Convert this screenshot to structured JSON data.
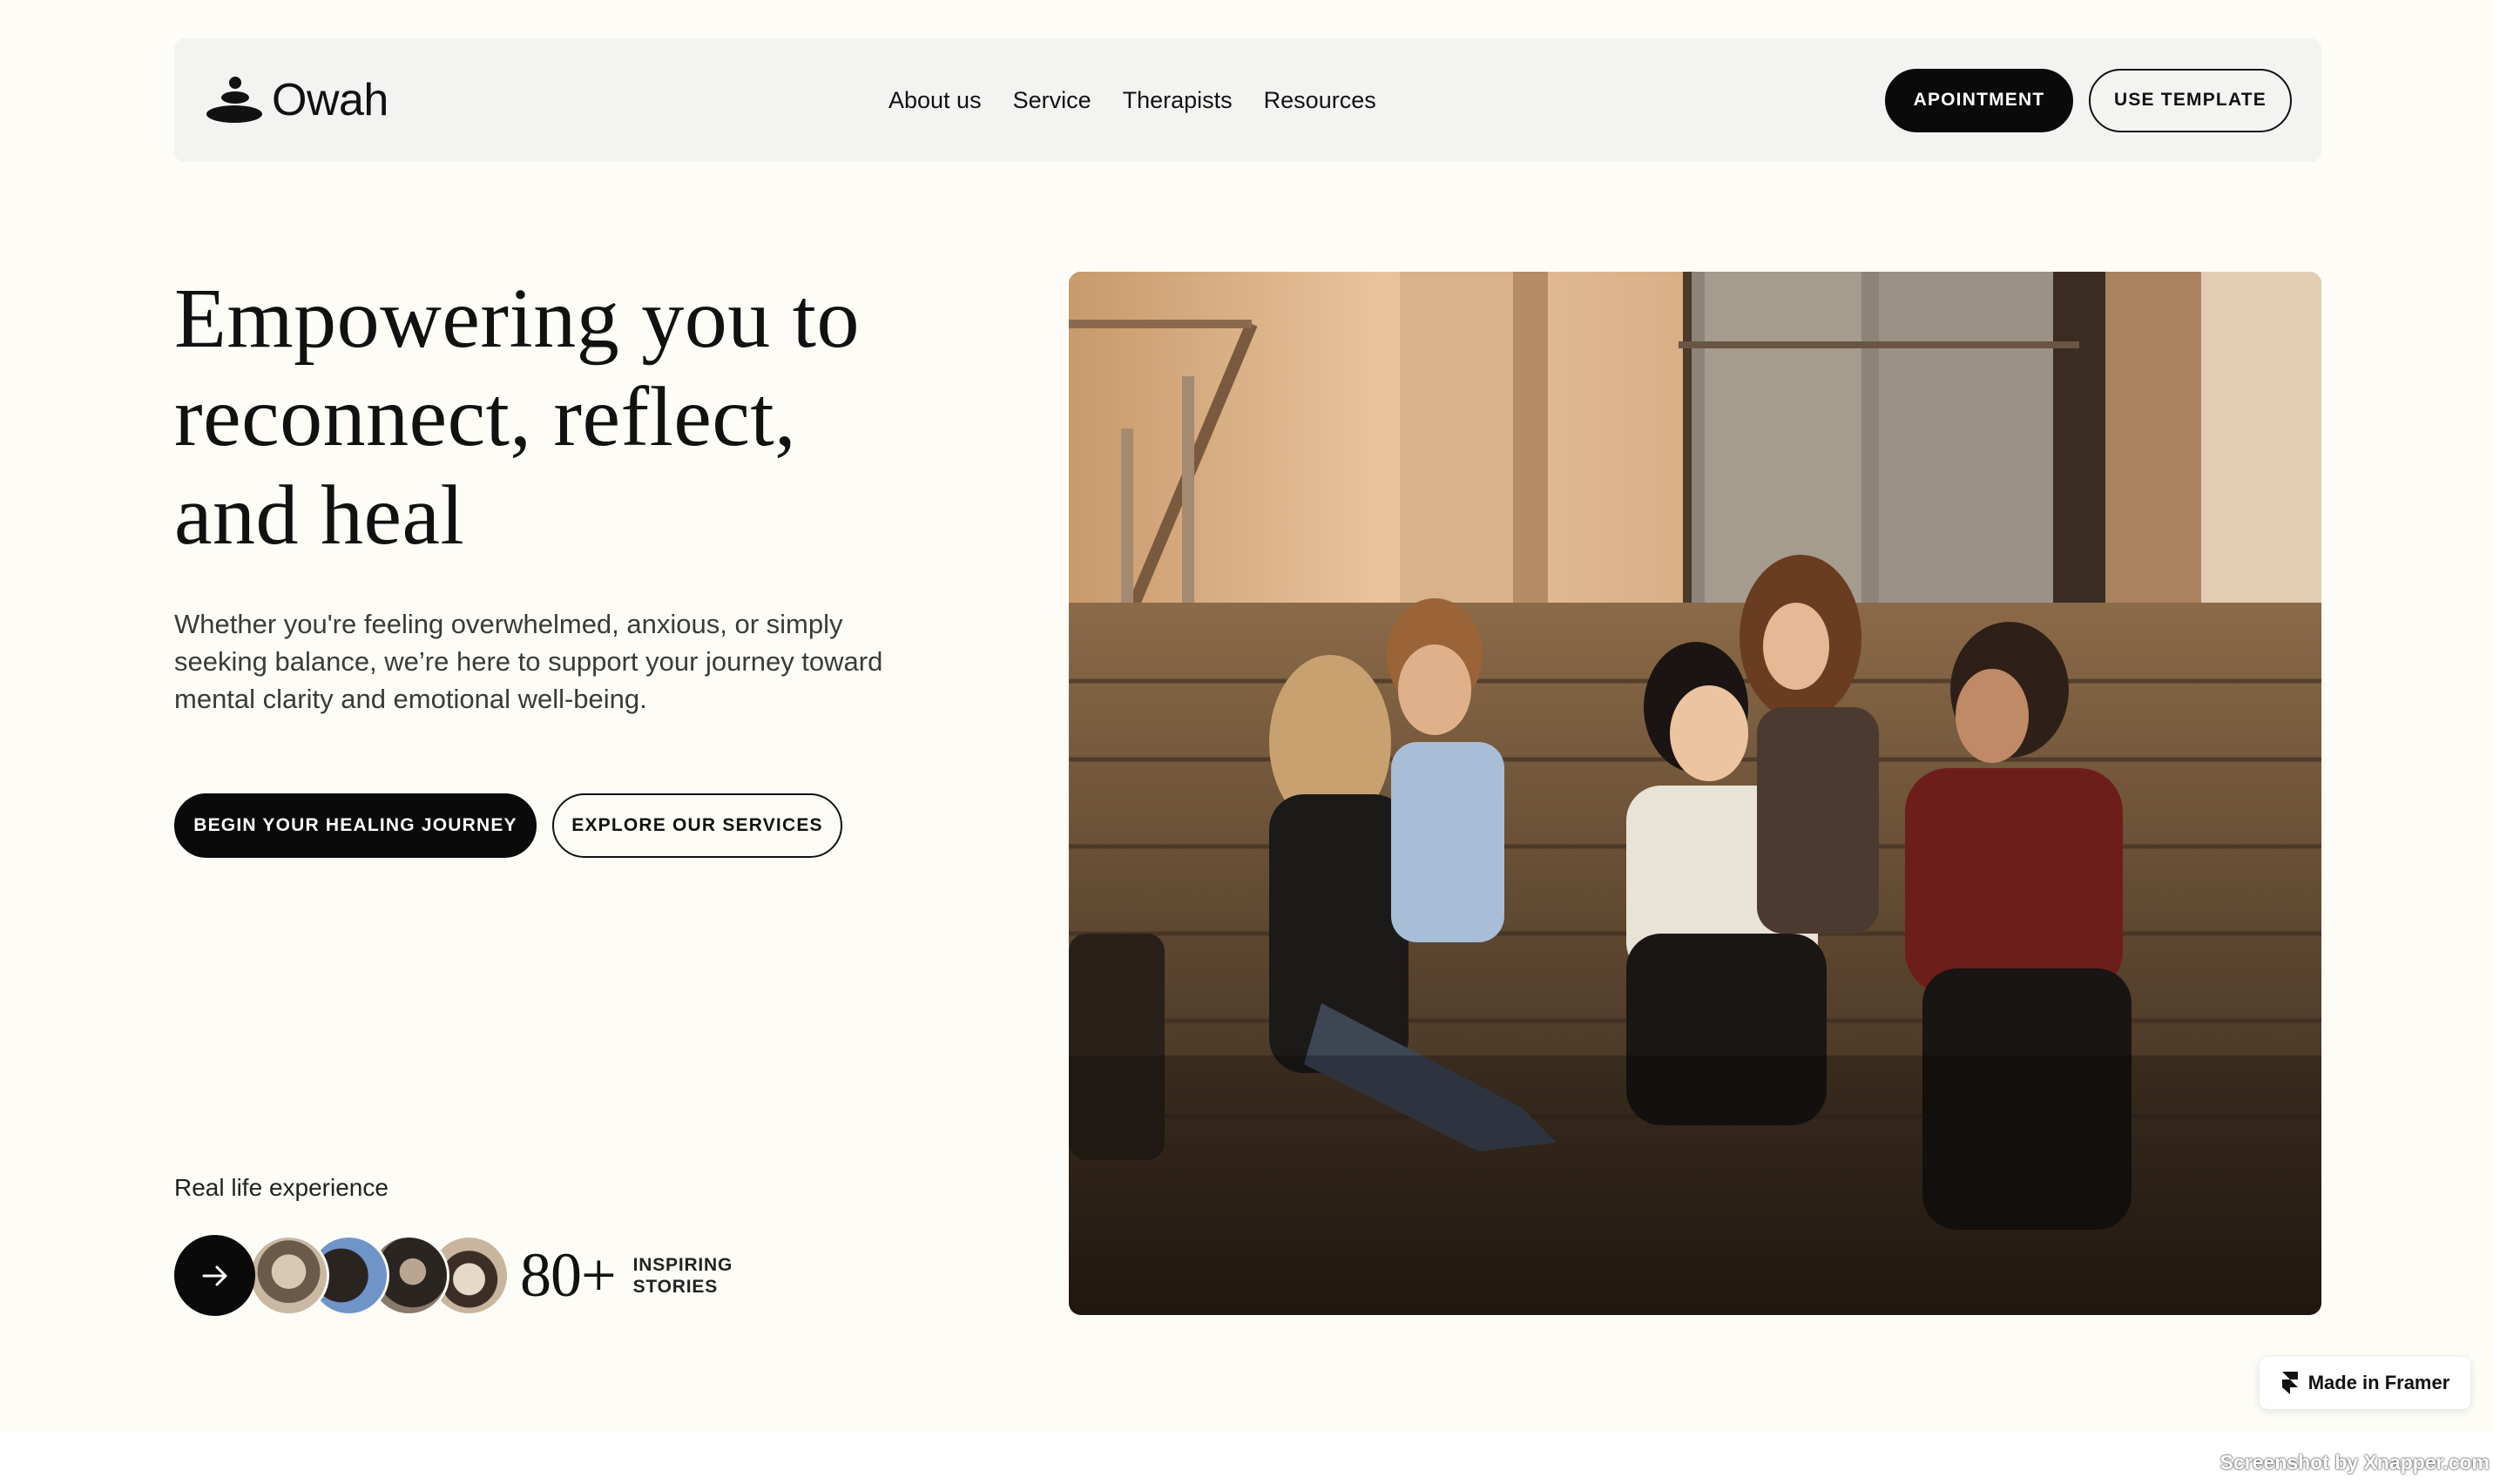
{
  "brand": {
    "name": "Owah"
  },
  "nav": {
    "links": [
      "About us",
      "Service",
      "Therapists",
      "Resources"
    ],
    "appointment_label": "APOINTMENT",
    "template_label": "USE TEMPLATE"
  },
  "hero": {
    "title_lines": [
      "Empowering you to",
      "reconnect, reflect,",
      "and heal"
    ],
    "subtitle": "Whether you're feeling overwhelmed, anxious, or simply seeking balance, we’re here to support your journey toward mental clarity and emotional well-being.",
    "primary_cta": "BEGIN YOUR HEALING JOURNEY",
    "secondary_cta": "EXPLORE OUR SERVICES"
  },
  "stories": {
    "heading": "Real life experience",
    "count": "80+",
    "label_line1": "INSPIRING",
    "label_line2": "STORIES"
  },
  "badge": {
    "label": "Made in Framer"
  },
  "watermark": "Screenshot by Xnapper.com",
  "colors": {
    "background": "#fdfcf7",
    "nav_bg": "#f3f3f1",
    "dark": "#0a0a0a"
  },
  "icons": [
    "owah-logo-icon",
    "arrow-right-icon",
    "framer-icon"
  ]
}
